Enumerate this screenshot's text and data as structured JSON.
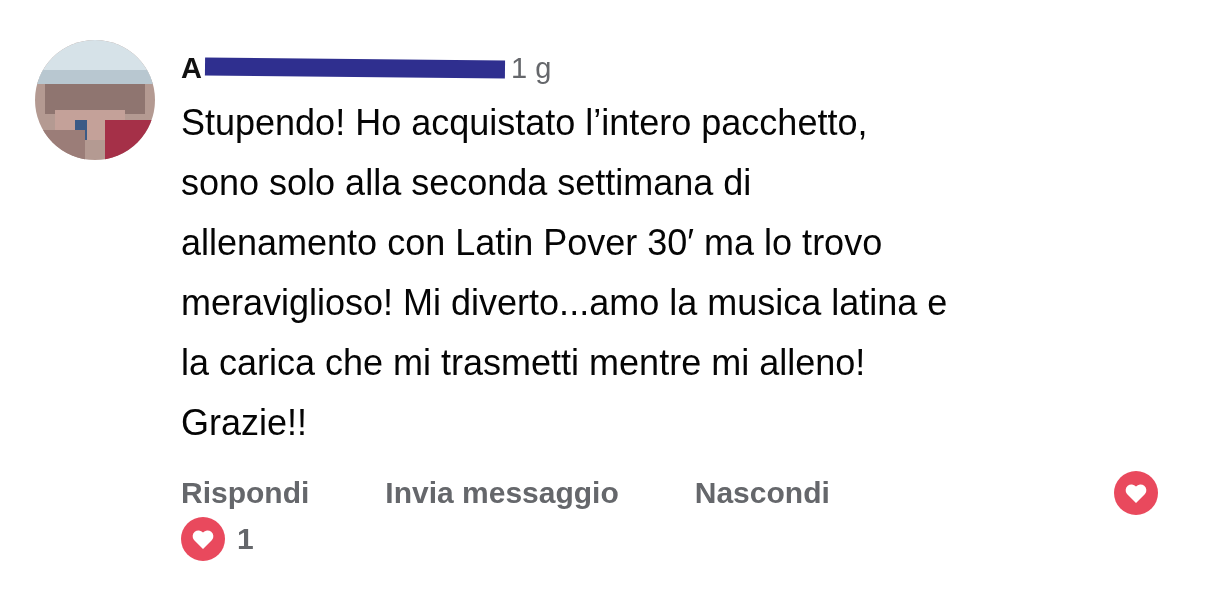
{
  "comment": {
    "author": "A",
    "redacted": true,
    "time": "1 g",
    "text_lines": [
      "Stupendo! Ho acquistato l’intero pacchetto,",
      "sono solo alla seconda settimana di",
      "allenamento con Latin Pover 30′ ma lo trovo",
      "meraviglioso! Mi diverto...amo la musica latina e",
      "la carica che mi trasmetti mentre mi alleno!",
      "Grazie!!"
    ],
    "actions": [
      "Rispondi",
      "Invia messaggio",
      "Nascondi"
    ],
    "liked": true,
    "reactions": {
      "count": "1"
    }
  }
}
